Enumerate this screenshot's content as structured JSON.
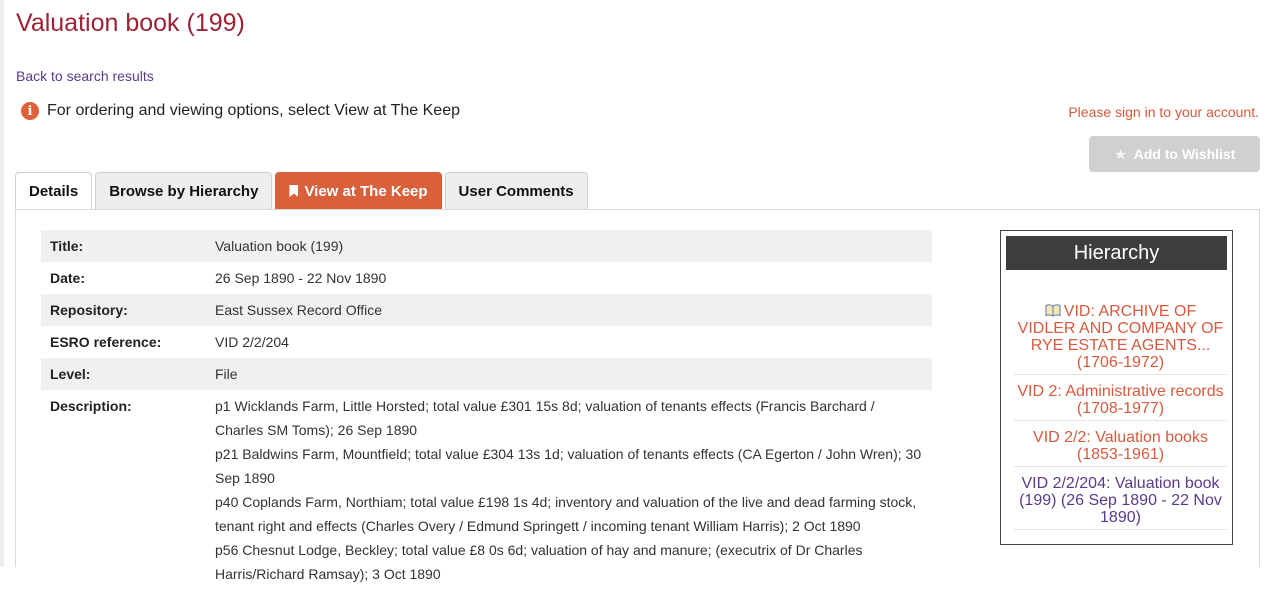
{
  "page": {
    "title": "Valuation book (199)",
    "back_link": "Back to search results",
    "info_message": "For ordering and viewing options, select View at The Keep",
    "signin_text": "Please sign in to your account.",
    "wishlist_label": "Add to Wishlist"
  },
  "tabs": [
    {
      "label": "Details"
    },
    {
      "label": "Browse by Hierarchy"
    },
    {
      "label": "View at The Keep"
    },
    {
      "label": "User Comments"
    }
  ],
  "details": {
    "title_label": "Title:",
    "title_value": "Valuation book (199)",
    "date_label": "Date:",
    "date_value": "26 Sep 1890 - 22 Nov 1890",
    "repository_label": "Repository:",
    "repository_value": "East Sussex Record Office",
    "reference_label": "ESRO reference:",
    "reference_value": "VID 2/2/204",
    "level_label": "Level:",
    "level_value": "File",
    "description_label": "Description:",
    "description": [
      "p1 Wicklands Farm, Little Horsted; total value £301 15s 8d; valuation of tenants effects (Francis Barchard / Charles SM Toms); 26 Sep 1890",
      "p21 Baldwins Farm, Mountfield; total value £304 13s 1d; valuation of tenants effects (CA Egerton / John Wren); 30 Sep 1890",
      "p40 Coplands Farm, Northiam; total value £198 1s 4d; inventory and valuation of the live and dead farming stock, tenant right and effects (Charles Overy / Edmund Springett / incoming tenant William Harris); 2 Oct 1890",
      "p56 Chesnut Lodge, Beckley; total value £8 0s 6d; valuation of hay and manure; (executrix of Dr Charles Harris/Richard Ramsay); 3 Oct 1890"
    ]
  },
  "hierarchy": {
    "title": "Hierarchy",
    "items": [
      "VID: ARCHIVE OF VIDLER AND COMPANY OF RYE ESTATE AGENTS... (1706-1972)",
      "VID 2: Administrative records (1708-1977)",
      "VID 2/2: Valuation books (1853-1961)",
      "VID 2/2/204: Valuation book (199) (26 Sep 1890 - 22 Nov 1890)"
    ]
  },
  "colors": {
    "title": "#9b2335",
    "accent": "#d9603b",
    "link": "#5b3a8a"
  }
}
